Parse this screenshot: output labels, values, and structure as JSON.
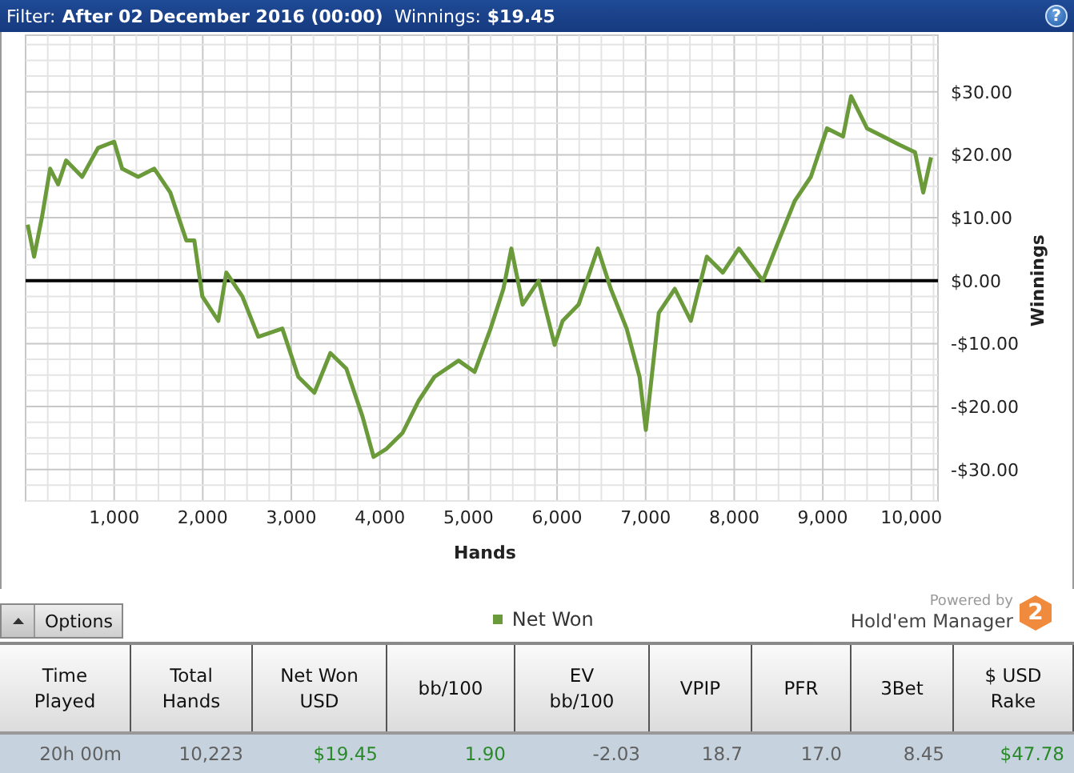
{
  "filter_bar": {
    "filter_label": "Filter:",
    "filter_value": "After 02 December 2016 (00:00)",
    "winnings_label": "Winnings:",
    "winnings_value": "$19.45",
    "help": "?"
  },
  "chart": {
    "chart_data": {
      "type": "line",
      "grid": true,
      "xlabel": "Hands",
      "ylabel": "Winnings",
      "xlim": [
        0,
        10300
      ],
      "ylim": [
        -35,
        39
      ],
      "xticks": [
        {
          "value": 1000,
          "label": "1,000"
        },
        {
          "value": 2000,
          "label": "2,000"
        },
        {
          "value": 3000,
          "label": "3,000"
        },
        {
          "value": 4000,
          "label": "4,000"
        },
        {
          "value": 5000,
          "label": "5,000"
        },
        {
          "value": 6000,
          "label": "6,000"
        },
        {
          "value": 7000,
          "label": "7,000"
        },
        {
          "value": 8000,
          "label": "8,000"
        },
        {
          "value": 9000,
          "label": "9,000"
        },
        {
          "value": 10000,
          "label": "10,000"
        }
      ],
      "yticks": [
        {
          "value": 30,
          "label": "$30.00"
        },
        {
          "value": 20,
          "label": "$20.00"
        },
        {
          "value": 10,
          "label": "$10.00"
        },
        {
          "value": 0,
          "label": "$0.00"
        },
        {
          "value": -10,
          "label": "-$10.00"
        },
        {
          "value": -20,
          "label": "-$20.00"
        },
        {
          "value": -30,
          "label": "-$30.00"
        }
      ],
      "x": [
        24,
        96,
        186,
        277,
        367,
        458,
        638,
        819,
        1000,
        1090,
        1271,
        1452,
        1633,
        1814,
        1904,
        1995,
        2176,
        2266,
        2447,
        2627,
        2899,
        3080,
        3260,
        3441,
        3622,
        3803,
        3929,
        4074,
        4255,
        4436,
        4616,
        4888,
        5068,
        5249,
        5394,
        5484,
        5610,
        5791,
        5972,
        6063,
        6243,
        6460,
        6606,
        6786,
        6931,
        7003,
        7148,
        7329,
        7510,
        7690,
        7871,
        8052,
        8324,
        8504,
        8685,
        8866,
        9047,
        9228,
        9318,
        9499,
        9680,
        9861,
        10042,
        10133,
        10223
      ],
      "series": [
        {
          "name": "Net Won",
          "color": "#6a9a3a",
          "values": [
            8.9,
            3.8,
            10.2,
            17.8,
            15.3,
            19.1,
            16.5,
            21.1,
            22.1,
            17.8,
            16.5,
            17.8,
            14.0,
            6.4,
            6.4,
            -2.5,
            -6.4,
            1.3,
            -2.5,
            -8.9,
            -7.6,
            -15.3,
            -17.8,
            -11.5,
            -14.0,
            -21.6,
            -28.0,
            -26.7,
            -24.2,
            -19.1,
            -15.3,
            -12.7,
            -14.5,
            -7.6,
            -1.3,
            5.1,
            -3.8,
            0,
            -10.2,
            -6.4,
            -3.8,
            5.1,
            -1.3,
            -7.6,
            -15.3,
            -23.7,
            -5.1,
            -1.3,
            -6.4,
            3.8,
            1.3,
            5.1,
            0,
            6.4,
            12.7,
            16.5,
            24.2,
            22.9,
            29.3,
            24.2,
            22.9,
            21.6,
            20.4,
            14.0,
            19.6
          ]
        }
      ]
    }
  },
  "footer": {
    "options_button": "Options",
    "powered_by": "Powered by",
    "brand": "Hold'em Manager",
    "brand_badge": "2"
  },
  "table": {
    "columns": [
      "Time\nPlayed",
      "Total\nHands",
      "Net Won\nUSD",
      "bb/100",
      "EV\nbb/100",
      "VPIP",
      "PFR",
      "3Bet",
      "$ USD\nRake"
    ],
    "rows": [
      {
        "cells": [
          {
            "text": "20h 00m",
            "color": "#606060"
          },
          {
            "text": "10,223",
            "color": "#606060"
          },
          {
            "text": "$19.45",
            "color": "#2a8a2a"
          },
          {
            "text": "1.90",
            "color": "#2a8a2a"
          },
          {
            "text": "-2.03",
            "color": "#606060"
          },
          {
            "text": "18.7",
            "color": "#606060"
          },
          {
            "text": "17.0",
            "color": "#606060"
          },
          {
            "text": "8.45",
            "color": "#606060"
          },
          {
            "text": "$47.78",
            "color": "#2a8a2a"
          }
        ]
      }
    ]
  }
}
